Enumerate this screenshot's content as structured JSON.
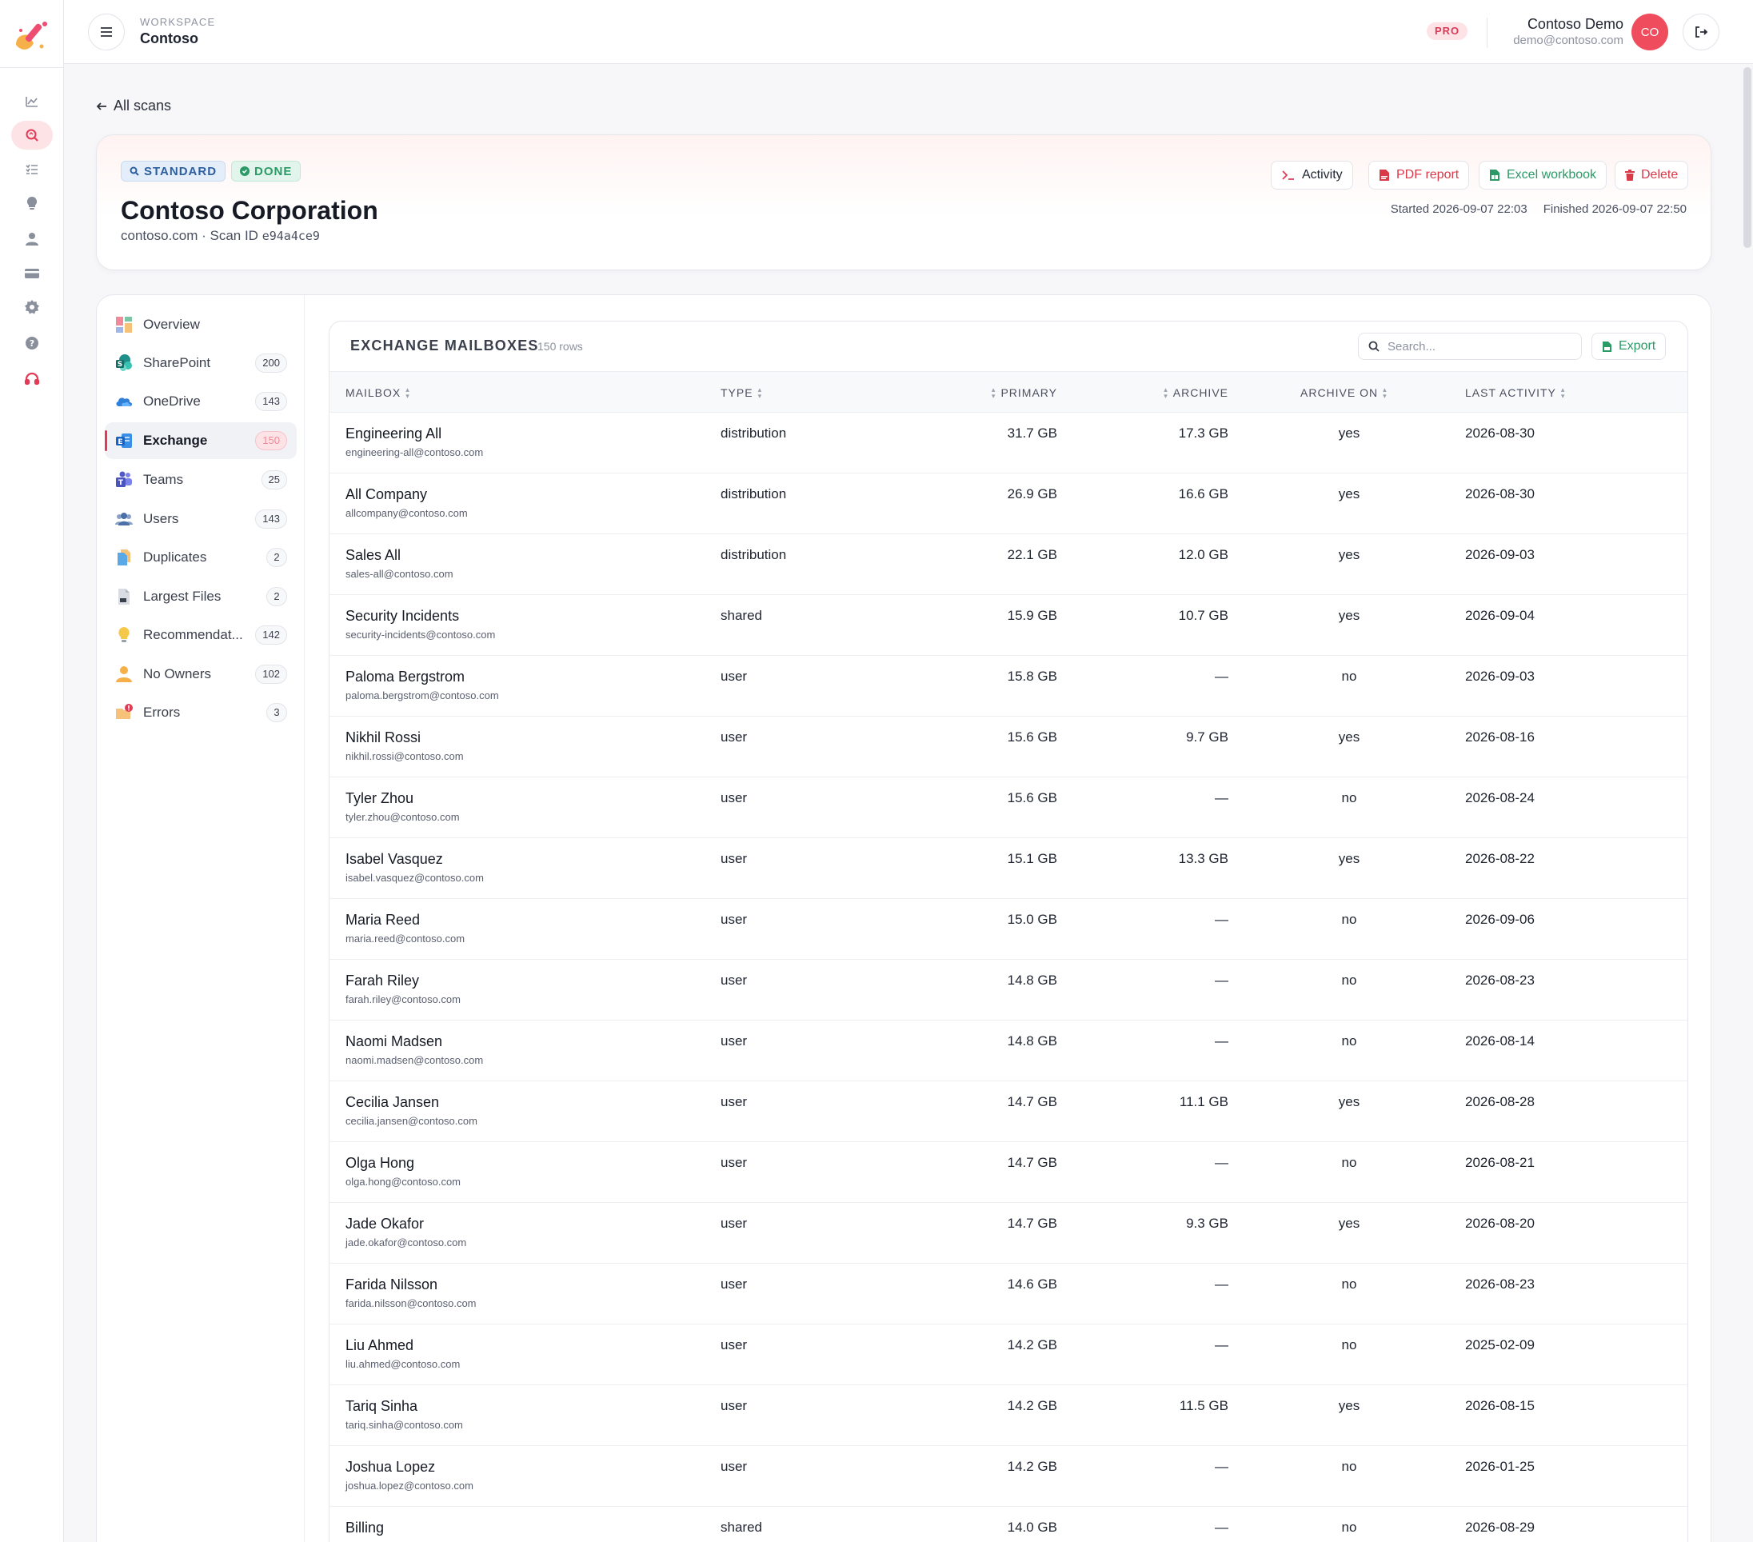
{
  "workspace": {
    "label": "WORKSPACE",
    "name": "Contoso"
  },
  "plan_badge": "PRO",
  "user": {
    "name": "Contoso Demo",
    "email": "demo@contoso.com",
    "initials": "CO"
  },
  "back_link": "All scans",
  "scan": {
    "badges": {
      "standard": "STANDARD",
      "done": "DONE"
    },
    "title": "Contoso Corporation",
    "domain_line": "contoso.com · Scan ID",
    "scan_id": "e94a4ce9",
    "actions": {
      "activity": "Activity",
      "pdf": "PDF report",
      "excel": "Excel workbook",
      "delete": "Delete"
    },
    "started": "Started 2026-09-07 22:03",
    "finished": "Finished 2026-09-07 22:50"
  },
  "nav": [
    {
      "label": "Overview",
      "count": ""
    },
    {
      "label": "SharePoint",
      "count": "200"
    },
    {
      "label": "OneDrive",
      "count": "143"
    },
    {
      "label": "Exchange",
      "count": "150"
    },
    {
      "label": "Teams",
      "count": "25"
    },
    {
      "label": "Users",
      "count": "143"
    },
    {
      "label": "Duplicates",
      "count": "2"
    },
    {
      "label": "Largest Files",
      "count": "2"
    },
    {
      "label": "Recommendat...",
      "count": "142"
    },
    {
      "label": "No Owners",
      "count": "102"
    },
    {
      "label": "Errors",
      "count": "3"
    }
  ],
  "table": {
    "title": "EXCHANGE MAILBOXES",
    "rows_count": "150 rows",
    "search_placeholder": "Search...",
    "export_label": "Export",
    "columns": {
      "mailbox": "MAILBOX",
      "type": "TYPE",
      "primary": "PRIMARY",
      "archive": "ARCHIVE",
      "archive_on": "ARCHIVE ON",
      "last_activity": "LAST ACTIVITY"
    },
    "rows": [
      {
        "name": "Engineering All",
        "email": "engineering-all@contoso.com",
        "type": "distribution",
        "primary": "31.7 GB",
        "archive": "17.3 GB",
        "archive_on": "yes",
        "last": "2026-08-30"
      },
      {
        "name": "All Company",
        "email": "allcompany@contoso.com",
        "type": "distribution",
        "primary": "26.9 GB",
        "archive": "16.6 GB",
        "archive_on": "yes",
        "last": "2026-08-30"
      },
      {
        "name": "Sales All",
        "email": "sales-all@contoso.com",
        "type": "distribution",
        "primary": "22.1 GB",
        "archive": "12.0 GB",
        "archive_on": "yes",
        "last": "2026-09-03"
      },
      {
        "name": "Security Incidents",
        "email": "security-incidents@contoso.com",
        "type": "shared",
        "primary": "15.9 GB",
        "archive": "10.7 GB",
        "archive_on": "yes",
        "last": "2026-09-04"
      },
      {
        "name": "Paloma Bergstrom",
        "email": "paloma.bergstrom@contoso.com",
        "type": "user",
        "primary": "15.8 GB",
        "archive": "—",
        "archive_on": "no",
        "last": "2026-09-03"
      },
      {
        "name": "Nikhil Rossi",
        "email": "nikhil.rossi@contoso.com",
        "type": "user",
        "primary": "15.6 GB",
        "archive": "9.7 GB",
        "archive_on": "yes",
        "last": "2026-08-16"
      },
      {
        "name": "Tyler Zhou",
        "email": "tyler.zhou@contoso.com",
        "type": "user",
        "primary": "15.6 GB",
        "archive": "—",
        "archive_on": "no",
        "last": "2026-08-24"
      },
      {
        "name": "Isabel Vasquez",
        "email": "isabel.vasquez@contoso.com",
        "type": "user",
        "primary": "15.1 GB",
        "archive": "13.3 GB",
        "archive_on": "yes",
        "last": "2026-08-22"
      },
      {
        "name": "Maria Reed",
        "email": "maria.reed@contoso.com",
        "type": "user",
        "primary": "15.0 GB",
        "archive": "—",
        "archive_on": "no",
        "last": "2026-09-06"
      },
      {
        "name": "Farah Riley",
        "email": "farah.riley@contoso.com",
        "type": "user",
        "primary": "14.8 GB",
        "archive": "—",
        "archive_on": "no",
        "last": "2026-08-23"
      },
      {
        "name": "Naomi Madsen",
        "email": "naomi.madsen@contoso.com",
        "type": "user",
        "primary": "14.8 GB",
        "archive": "—",
        "archive_on": "no",
        "last": "2026-08-14"
      },
      {
        "name": "Cecilia Jansen",
        "email": "cecilia.jansen@contoso.com",
        "type": "user",
        "primary": "14.7 GB",
        "archive": "11.1 GB",
        "archive_on": "yes",
        "last": "2026-08-28"
      },
      {
        "name": "Olga Hong",
        "email": "olga.hong@contoso.com",
        "type": "user",
        "primary": "14.7 GB",
        "archive": "—",
        "archive_on": "no",
        "last": "2026-08-21"
      },
      {
        "name": "Jade Okafor",
        "email": "jade.okafor@contoso.com",
        "type": "user",
        "primary": "14.7 GB",
        "archive": "9.3 GB",
        "archive_on": "yes",
        "last": "2026-08-20"
      },
      {
        "name": "Farida Nilsson",
        "email": "farida.nilsson@contoso.com",
        "type": "user",
        "primary": "14.6 GB",
        "archive": "—",
        "archive_on": "no",
        "last": "2026-08-23"
      },
      {
        "name": "Liu Ahmed",
        "email": "liu.ahmed@contoso.com",
        "type": "user",
        "primary": "14.2 GB",
        "archive": "—",
        "archive_on": "no",
        "last": "2025-02-09"
      },
      {
        "name": "Tariq Sinha",
        "email": "tariq.sinha@contoso.com",
        "type": "user",
        "primary": "14.2 GB",
        "archive": "11.5 GB",
        "archive_on": "yes",
        "last": "2026-08-15"
      },
      {
        "name": "Joshua Lopez",
        "email": "joshua.lopez@contoso.com",
        "type": "user",
        "primary": "14.2 GB",
        "archive": "—",
        "archive_on": "no",
        "last": "2026-01-25"
      },
      {
        "name": "Billing",
        "email": "",
        "type": "shared",
        "primary": "14.0 GB",
        "archive": "—",
        "archive_on": "no",
        "last": "2026-08-29"
      }
    ]
  },
  "colors": {
    "accent": "#e23a55",
    "success": "#2c9a66",
    "info": "#2d5f9e"
  }
}
